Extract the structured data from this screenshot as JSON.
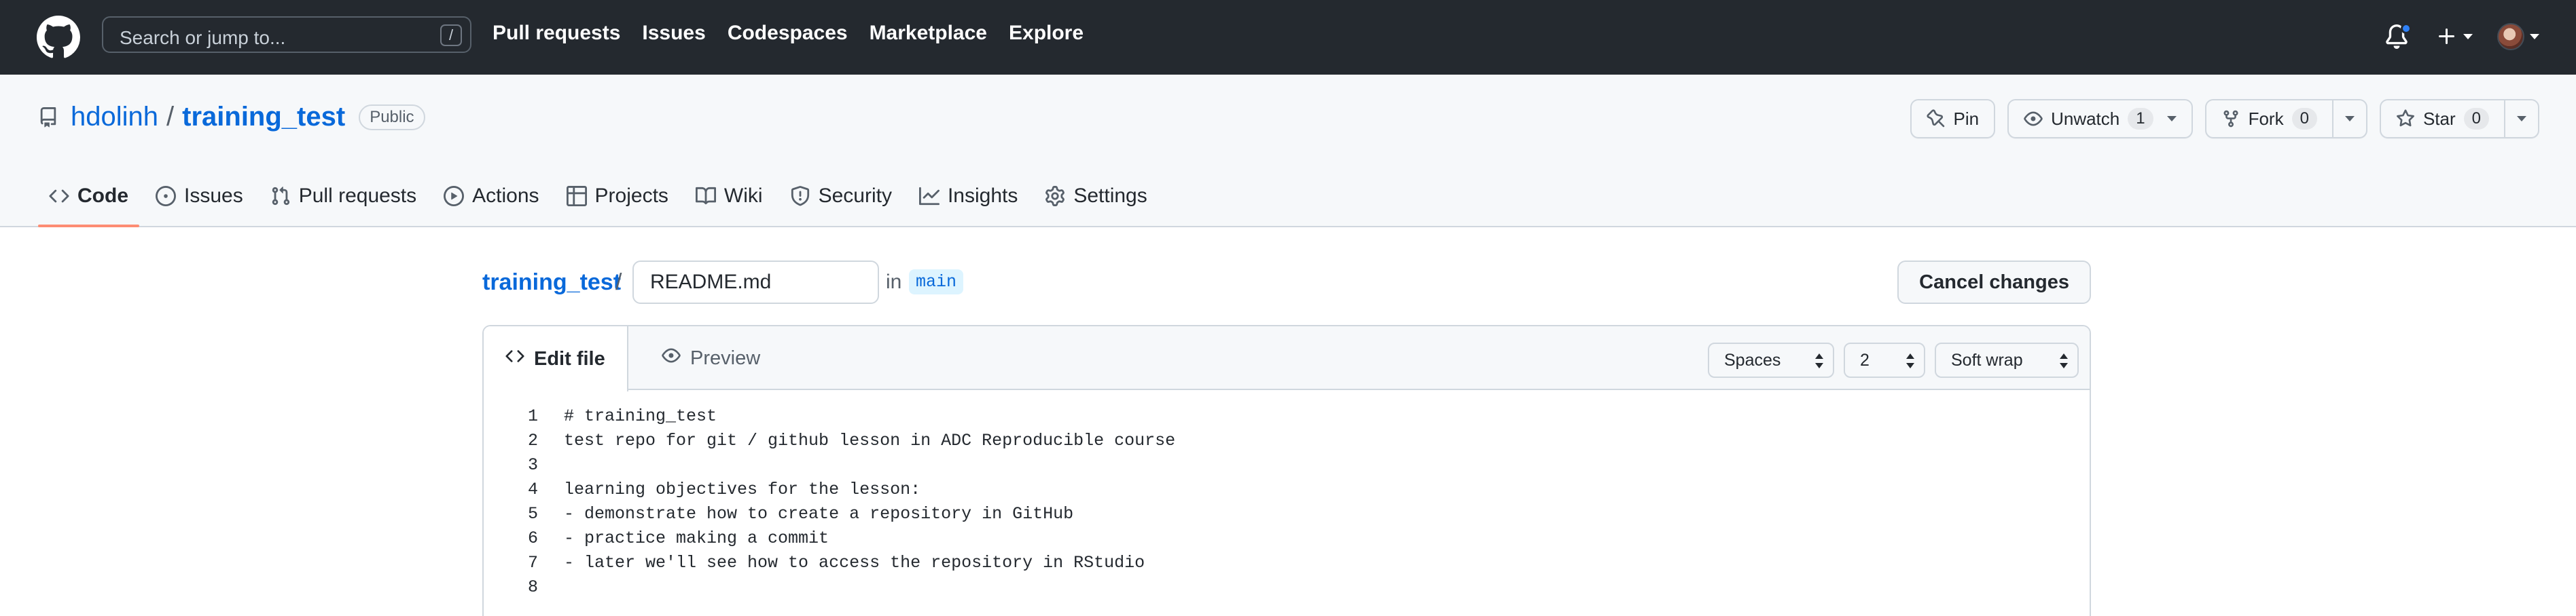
{
  "header": {
    "search_placeholder": "Search or jump to...",
    "search_shortcut": "/",
    "nav": [
      "Pull requests",
      "Issues",
      "Codespaces",
      "Marketplace",
      "Explore"
    ],
    "notification_dot_color": "#2f81f7"
  },
  "repo": {
    "owner": "hdolinh",
    "separator": "/",
    "name": "training_test",
    "visibility": "Public",
    "actions": {
      "pin_label": "Pin",
      "watch_label": "Unwatch",
      "watch_count": "1",
      "fork_label": "Fork",
      "fork_count": "0",
      "star_label": "Star",
      "star_count": "0"
    },
    "tabs": [
      {
        "label": "Code",
        "icon": "code-icon",
        "active": true
      },
      {
        "label": "Issues",
        "icon": "issue-icon"
      },
      {
        "label": "Pull requests",
        "icon": "pull-request-icon"
      },
      {
        "label": "Actions",
        "icon": "play-icon"
      },
      {
        "label": "Projects",
        "icon": "table-icon"
      },
      {
        "label": "Wiki",
        "icon": "book-icon"
      },
      {
        "label": "Security",
        "icon": "shield-icon"
      },
      {
        "label": "Insights",
        "icon": "graph-icon"
      },
      {
        "label": "Settings",
        "icon": "gear-icon"
      }
    ],
    "active_tab_color": "#fd8c73"
  },
  "editor": {
    "path_repo": "training_test",
    "path_sep": "/",
    "filename": "README.md",
    "in_label": "in",
    "branch": "main",
    "cancel_label": "Cancel changes",
    "tab_edit": "Edit file",
    "tab_preview": "Preview",
    "indent_mode": "Spaces",
    "indent_size": "2",
    "wrap_mode": "Soft wrap",
    "lines": [
      "# training_test",
      "test repo for git / github lesson in ADC Reproducible course",
      "",
      "learning objectives for the lesson:",
      "- demonstrate how to create a repository in GitHub",
      "- practice making a commit",
      "- later we'll see how to access the repository in RStudio",
      ""
    ]
  }
}
